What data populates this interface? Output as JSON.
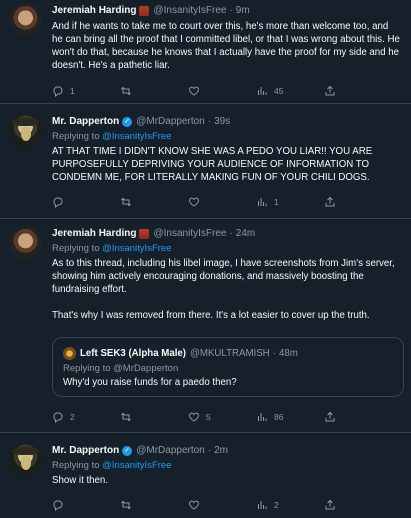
{
  "tweets": [
    {
      "name": "Jeremiah Harding",
      "handle": "@InsanityIsFree",
      "time": "9m",
      "replying_to": "",
      "paragraphs": [
        "And if he wants to take me to court over this, he's more than welcome too, and he can bring all the proof that I committed libel, or that I was wrong about this. He won't do that, because he knows that I actually have the proof for my side and he doesn't. He's a pathetic liar."
      ],
      "replies": "1",
      "retweets": "",
      "likes": "",
      "views": "45"
    },
    {
      "name": "Mr. Dapperton",
      "handle": "@MrDapperton",
      "time": "39s",
      "replying_prefix": "Replying to",
      "replying_to": "@InsanityIsFree",
      "paragraphs": [
        "AT THAT TIME I DIDN'T KNOW SHE WAS A PEDO YOU LIAR!! YOU ARE PURPOSEFULLY DEPRIVING YOUR AUDIENCE OF INFORMATION TO CONDEMN ME, FOR LITERALLY MAKING FUN OF YOUR CHILI DOGS."
      ],
      "replies": "",
      "retweets": "",
      "likes": "",
      "views": "1"
    },
    {
      "name": "Jeremiah Harding",
      "handle": "@InsanityIsFree",
      "time": "24m",
      "replying_prefix": "Replying to",
      "replying_to": "@InsanityIsFree",
      "paragraphs": [
        "As to this thread, including his libel image, I have screenshots from Jim's server, showing him actively encouraging donations, and massively boosting the fundraising effort.",
        "That's why I was removed from there. It's a lot easier to cover up the truth."
      ],
      "quote": {
        "name": "Left SEK3 (Alpha Male)",
        "handle": "@MKULTRAMISH",
        "time": "48m",
        "replying": "Replying to @MrDapperton",
        "text": "Why'd you raise funds for a paedo then?"
      },
      "replies": "2",
      "retweets": "",
      "likes": "5",
      "views": "86"
    },
    {
      "name": "Mr. Dapperton",
      "handle": "@MrDapperton",
      "time": "2m",
      "replying_prefix": "Replying to",
      "replying_to": "@InsanityIsFree",
      "paragraphs": [
        "Show it then."
      ],
      "replies": "",
      "retweets": "",
      "likes": "",
      "views": "2"
    }
  ],
  "dot": "·",
  "icons": {
    "reply": "reply-icon",
    "retweet": "retweet-icon",
    "like": "heart-icon",
    "views": "views-icon",
    "share": "share-icon",
    "verified": "verified-badge-icon",
    "emoji": "emoji-badge-icon"
  }
}
